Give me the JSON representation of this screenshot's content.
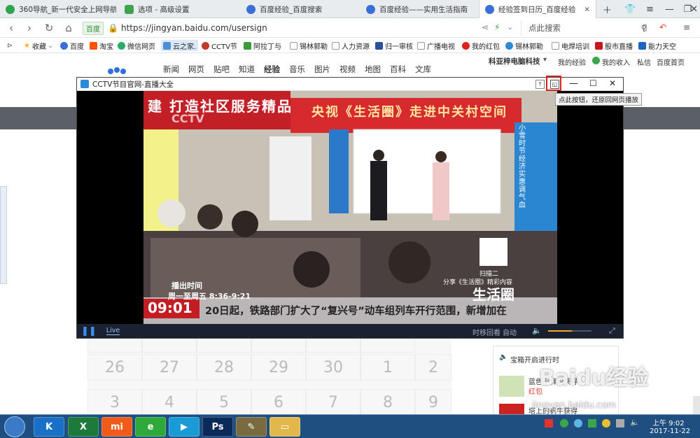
{
  "tabs": [
    {
      "title": "360导航_新一代安全上网导航",
      "color": "#2ea44f"
    },
    {
      "title": "选项 - 高级设置",
      "color": "#3fa34d"
    },
    {
      "title": "百度经验_百度搜索",
      "color": "#3a6ed8"
    },
    {
      "title": "百度经验——实用生活指南",
      "color": "#3a6ed8"
    },
    {
      "title": "经验签到日历_百度经验",
      "color": "#3a6ed8"
    }
  ],
  "addressbar": {
    "badge": "百度",
    "url": "https://jingyan.baidu.com/usersign",
    "search_placeholder": "点此搜索"
  },
  "bookmarks": [
    "收藏",
    "百度",
    "淘宝",
    "微信网页",
    "云之家.",
    "CCTV节",
    "阿拉丁与",
    "锡林郭勒",
    "人力资源",
    "归一审核",
    "广播电视",
    "我的红包",
    "锡林郭勒",
    "电焊培训",
    "股市直播",
    "能力天空"
  ],
  "page": {
    "nav": [
      "新闻",
      "网页",
      "贴吧",
      "知道",
      "经验",
      "音乐",
      "图片",
      "视频",
      "地图",
      "百科",
      "文库"
    ],
    "user": "科亚梓电脑科技",
    "user_links": [
      "我的经验",
      "我的收入",
      "私信",
      "百度首页"
    ],
    "calendar_days": [
      "26",
      "27",
      "28",
      "29",
      "30",
      "1",
      "2",
      "3",
      "4",
      "5",
      "6",
      "7",
      "8",
      "9"
    ],
    "sidebar_title": "宝箱开启进行时",
    "sidebar_items": [
      "蓝色小狮的获得",
      "红包",
      "塔上的帆牛获得"
    ]
  },
  "player": {
    "title": "CCTV节目官网-直播大全",
    "tooltip": "点此按钮，还原回网页播放",
    "live_label": "Live",
    "timeshift": "时移回看",
    "auto": "自动",
    "volume": 0.55
  },
  "video": {
    "banner_left": "建 打造社区服务精品",
    "banner_right": "央视《生活圈》走进中关村空间",
    "side_text": "小雪时节 经济实惠调气血",
    "schedule_title": "播出时间",
    "schedule_days": "周一至周五 8:36-9:21",
    "clock": "09:01",
    "ticker": "20日起，铁路部门扩大了“复兴号”动车组列车开行范围，新增加在",
    "qr_caption": "扫描二",
    "share_caption": "分享《生活圈》精彩内容",
    "brand": "生活圈",
    "cctv": "CCTV"
  },
  "watermark": {
    "brand": "Baidu经验",
    "url": "jingyan.baidu.com"
  },
  "taskbar": {
    "time": "上午 9:02",
    "date": "2017-11-22"
  }
}
